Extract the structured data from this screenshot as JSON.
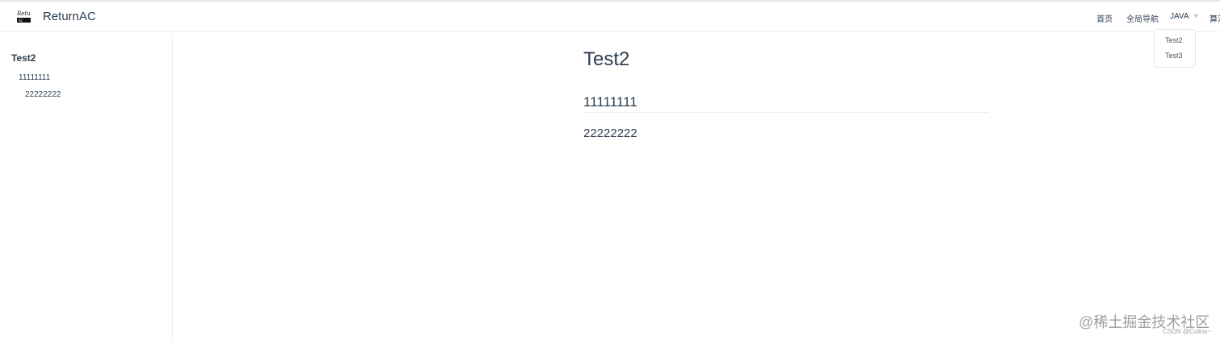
{
  "navbar": {
    "logo_icon": "avatar-logo",
    "site_name": "ReturnAC",
    "links": [
      {
        "label": "首页"
      },
      {
        "label": "全局导航"
      },
      {
        "label": "JAVA"
      },
      {
        "label": "算法"
      }
    ],
    "dropdown": {
      "items": [
        "Test2",
        "Test3"
      ]
    }
  },
  "sidebar": {
    "title": "Test2",
    "links": [
      "11111111",
      "22222222"
    ]
  },
  "content": {
    "title": "Test2",
    "h2": "11111111",
    "h3": "22222222"
  },
  "watermark": {
    "text": "@稀土掘金技术社区",
    "sub": "CSDN @Colins~"
  }
}
